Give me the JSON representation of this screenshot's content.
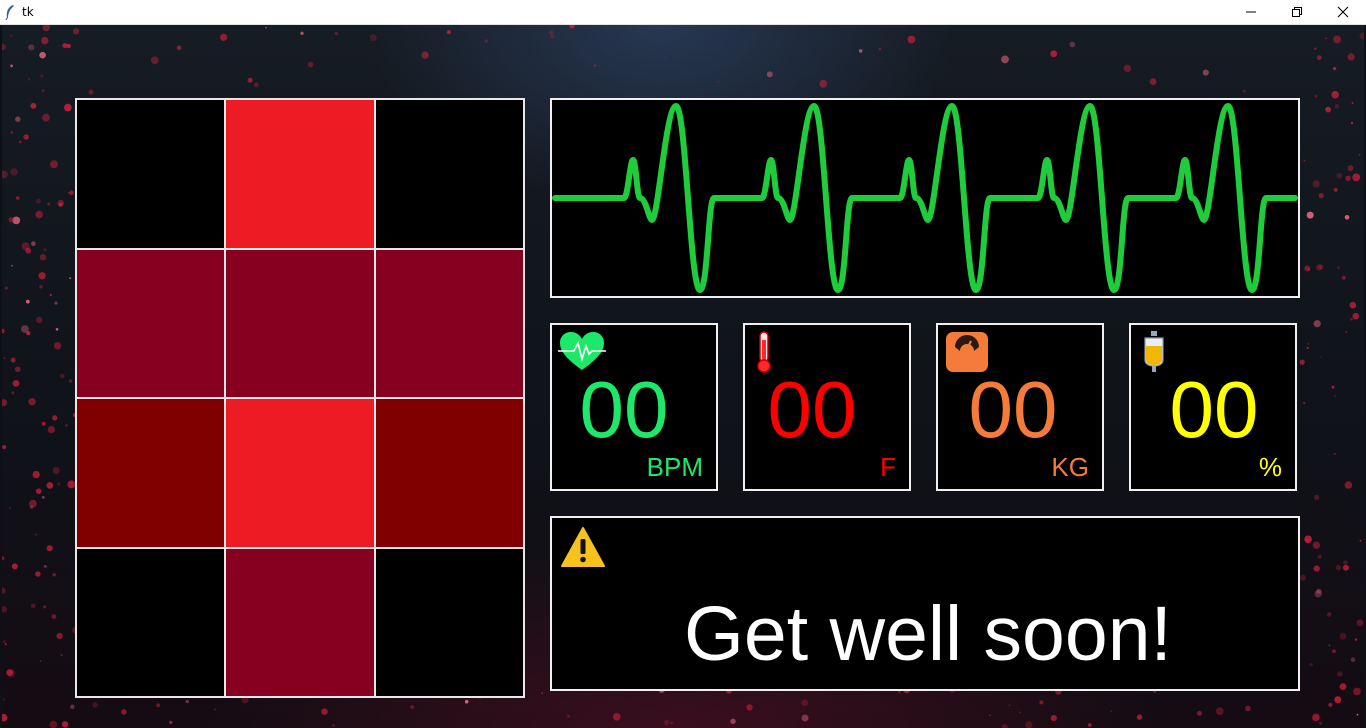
{
  "window": {
    "title": "tk"
  },
  "grid": {
    "cells": [
      {
        "color": "#000000"
      },
      {
        "color": "#ed1c24"
      },
      {
        "color": "#000000"
      },
      {
        "color": "#880020"
      },
      {
        "color": "#880020"
      },
      {
        "color": "#880020"
      },
      {
        "color": "#800000"
      },
      {
        "color": "#ed1c24"
      },
      {
        "color": "#800000"
      },
      {
        "color": "#000000"
      },
      {
        "color": "#880020"
      },
      {
        "color": "#000000"
      }
    ]
  },
  "ecg": {
    "color": "#1fcc3c",
    "icon": "heartbeat-waveform"
  },
  "metrics": [
    {
      "icon": "heart-pulse-icon",
      "value": "00",
      "unit": "BPM",
      "color": "#1ee86a"
    },
    {
      "icon": "thermometer-icon",
      "value": "00",
      "unit": "F",
      "color": "#ff0000"
    },
    {
      "icon": "weighing-scale-icon",
      "value": "00",
      "unit": "KG",
      "color": "#f47b3a"
    },
    {
      "icon": "iv-bag-icon",
      "value": "00",
      "unit": "%",
      "color": "#ffff00"
    }
  ],
  "message": {
    "icon": "warning-icon",
    "text": "Get well soon!"
  }
}
